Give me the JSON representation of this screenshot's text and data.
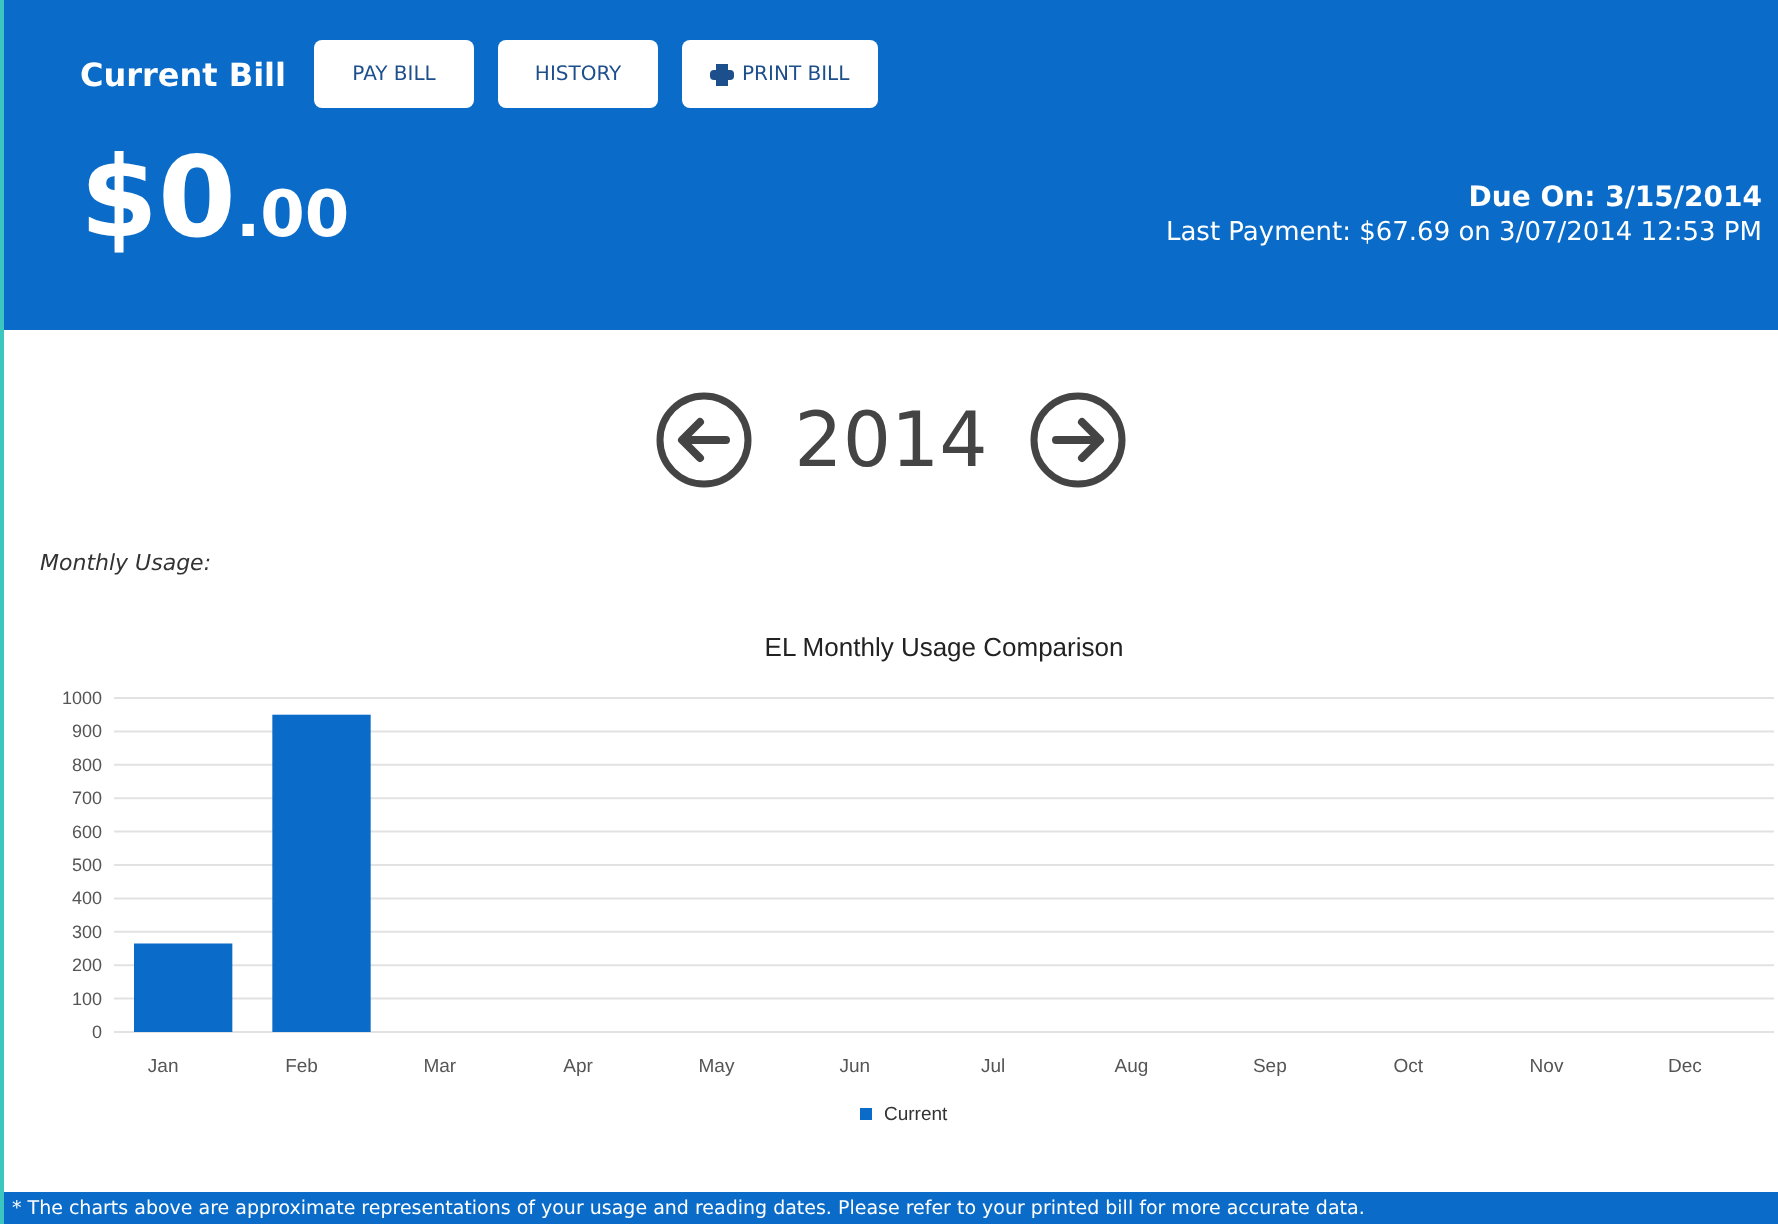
{
  "header": {
    "title": "Current Bill",
    "buttons": [
      {
        "label": "PAY BILL",
        "kind": "plain"
      },
      {
        "label": "HISTORY",
        "kind": "plain"
      },
      {
        "label": "PRINT BILL",
        "kind": "print"
      }
    ],
    "amount": {
      "whole": "$0",
      "cents": ".00"
    },
    "due": "Due On: 3/15/2014",
    "last_payment": "Last Payment: $67.69 on 3/07/2014 12:53 PM"
  },
  "year_nav": {
    "year": "2014"
  },
  "section_label": "Monthly Usage:",
  "chart_data": {
    "type": "bar",
    "title": "EL Monthly Usage Comparison",
    "categories": [
      "Jan",
      "Feb",
      "Mar",
      "Apr",
      "May",
      "Jun",
      "Jul",
      "Aug",
      "Sep",
      "Oct",
      "Nov",
      "Dec"
    ],
    "series": [
      {
        "name": "Current",
        "color": "#0a6cc8",
        "values": [
          265,
          950,
          null,
          null,
          null,
          null,
          null,
          null,
          null,
          null,
          null,
          null
        ]
      }
    ],
    "grid": true,
    "ylim": [
      0,
      1000
    ],
    "yticks": [
      0,
      100,
      200,
      300,
      400,
      500,
      600,
      700,
      800,
      900,
      1000
    ]
  },
  "footnote": "* The charts above are approximate representations of your usage and reading dates. Please refer to your printed bill for more accurate data."
}
